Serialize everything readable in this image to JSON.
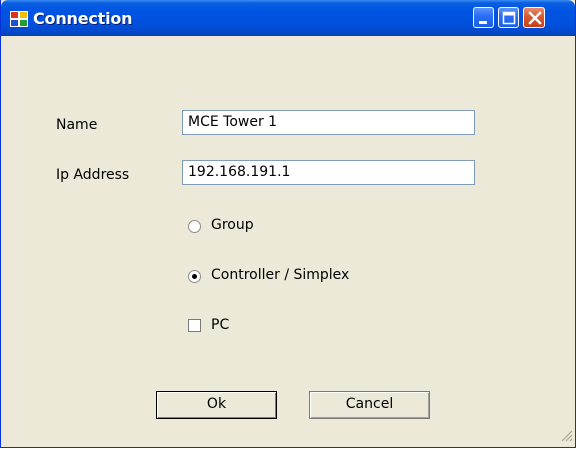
{
  "window": {
    "title": "Connection",
    "icons": {
      "app": "app-window-icon",
      "minimize": "minimize-icon",
      "maximize": "maximize-icon",
      "close": "close-icon"
    }
  },
  "form": {
    "name_label": "Name",
    "name_value": "MCE Tower 1",
    "ip_label": "Ip Address",
    "ip_value": "192.168.191.1",
    "options": [
      {
        "label": "Group",
        "type": "radio",
        "checked": false
      },
      {
        "label": "Controller / Simplex",
        "type": "radio",
        "checked": true
      },
      {
        "label": "PC",
        "type": "checkbox",
        "checked": false
      }
    ]
  },
  "buttons": {
    "ok": "Ok",
    "cancel": "Cancel"
  },
  "colors": {
    "titlebar": "#0054e3",
    "face": "#ece9d8",
    "close": "#d85a30"
  }
}
